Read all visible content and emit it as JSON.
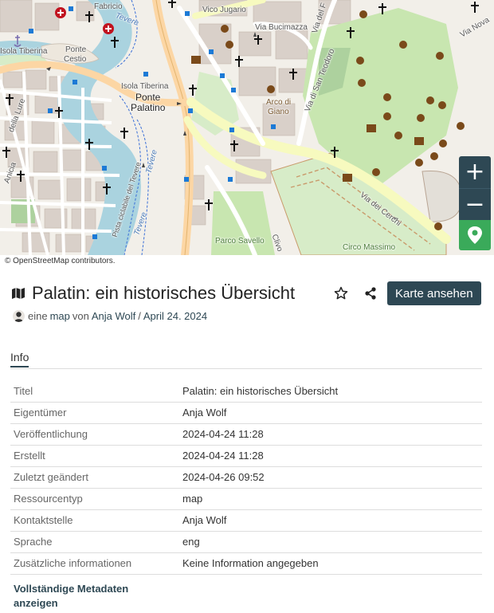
{
  "map": {
    "labels": {
      "fabricio": "Fabricio",
      "ponte_cestio_1": "Ponte",
      "ponte_cestio_2": "Cestio",
      "isola_tiberina_left": "Isola Tiberina",
      "isola_tiberina": "Isola Tiberina",
      "ponte_palatino_1": "Ponte",
      "ponte_palatino_2": "Palatino",
      "tevere_top": "Tevere",
      "tevere_mid": "Tevere",
      "tevere_low": "Tevere",
      "vico_jugario": "Vico Jugario",
      "via_bucimazza": "Via Bucimazza",
      "via_di_san_teodoro": "Via di San Teodoro",
      "arco_di_giano_1": "Arco di",
      "arco_di_giano_2": "Giano",
      "via_dei_cerchi": "Via dei Cerchi",
      "circo_massimo": "Circo Massimo",
      "parco_savello": "Parco Savello",
      "pista_ciclabile": "Pista ciclabile del Tevere",
      "via_nova": "Via Nova",
      "della_lure": "della Lure",
      "anicia": "Anicia",
      "clivo": "Clivo",
      "via_del_foro": "Via del F"
    },
    "zoom_in_label": "+",
    "zoom_out_label": "−",
    "locate_icon": "map-marker-icon",
    "attribution_prefix": "© ",
    "attribution_link": "OpenStreetMap",
    "attribution_suffix": " contributors."
  },
  "header": {
    "title": "Palatin: ein historisches Übersicht",
    "title_icon": "map-icon",
    "favorite_icon": "star-outline-icon",
    "share_icon": "share-icon",
    "view_button": "Karte ansehen"
  },
  "byline": {
    "prefix": "eine",
    "resource_type": "map",
    "by": "von",
    "owner": "Anja Wolf",
    "separator": "/",
    "date": "April 24. 2024"
  },
  "tabs": {
    "info": "Info"
  },
  "metadata": {
    "rows": [
      {
        "key": "Titel",
        "value": "Palatin: ein historisches Übersicht"
      },
      {
        "key": "Eigentümer",
        "value": "Anja Wolf"
      },
      {
        "key": "Veröffentlichung",
        "value": "2024-04-24 11:28"
      },
      {
        "key": "Erstellt",
        "value": "2024-04-24 11:28"
      },
      {
        "key": "Zuletzt geändert",
        "value": "2024-04-26 09:52"
      },
      {
        "key": "Ressourcentyp",
        "value": "map"
      },
      {
        "key": "Kontaktstelle",
        "value": "Anja Wolf"
      },
      {
        "key": "Sprache",
        "value": "eng"
      },
      {
        "key": "Zusätzliche informationen",
        "value": "Keine Information angegeben"
      }
    ],
    "full_link": "Vollständige Metadaten anzeigen"
  },
  "colors": {
    "accent": "#2e4854",
    "locate": "#3aaa5a",
    "river": "#aad3df",
    "park": "#c8e6b0",
    "road_major": "#fcd6a4",
    "road_minor": "#ffffff"
  }
}
